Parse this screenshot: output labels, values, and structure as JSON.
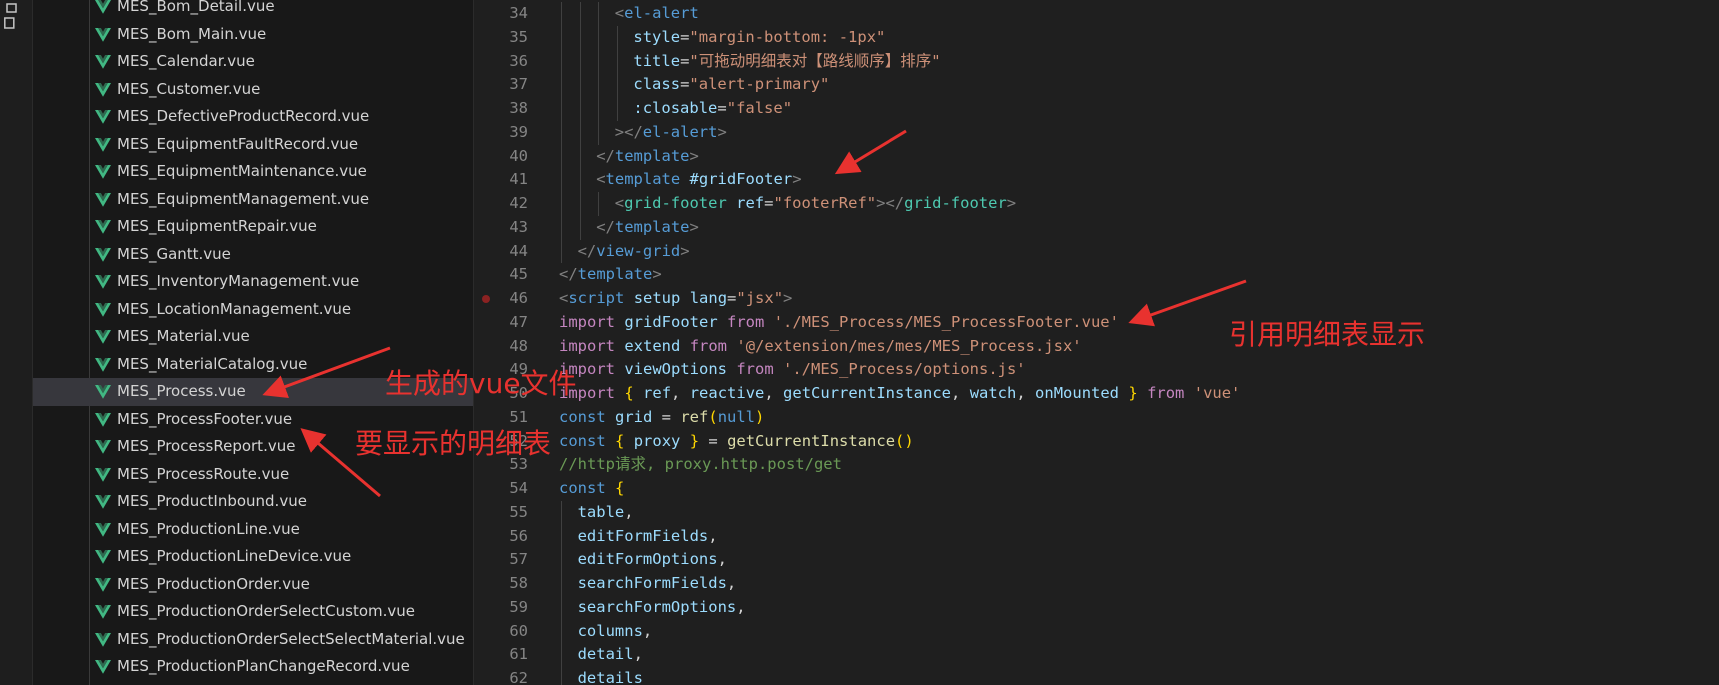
{
  "explorer": {
    "files": [
      {
        "name": "MES_Bom_Detail.vue"
      },
      {
        "name": "MES_Bom_Main.vue"
      },
      {
        "name": "MES_Calendar.vue"
      },
      {
        "name": "MES_Customer.vue"
      },
      {
        "name": "MES_DefectiveProductRecord.vue"
      },
      {
        "name": "MES_EquipmentFaultRecord.vue"
      },
      {
        "name": "MES_EquipmentMaintenance.vue"
      },
      {
        "name": "MES_EquipmentManagement.vue"
      },
      {
        "name": "MES_EquipmentRepair.vue"
      },
      {
        "name": "MES_Gantt.vue"
      },
      {
        "name": "MES_InventoryManagement.vue"
      },
      {
        "name": "MES_LocationManagement.vue"
      },
      {
        "name": "MES_Material.vue"
      },
      {
        "name": "MES_MaterialCatalog.vue"
      },
      {
        "name": "MES_Process.vue",
        "active": true
      },
      {
        "name": "MES_ProcessFooter.vue"
      },
      {
        "name": "MES_ProcessReport.vue"
      },
      {
        "name": "MES_ProcessRoute.vue"
      },
      {
        "name": "MES_ProductInbound.vue"
      },
      {
        "name": "MES_ProductionLine.vue"
      },
      {
        "name": "MES_ProductionLineDevice.vue"
      },
      {
        "name": "MES_ProductionOrder.vue"
      },
      {
        "name": "MES_ProductionOrderSelectCustom.vue"
      },
      {
        "name": "MES_ProductionOrderSelectSelectMaterial.vue"
      },
      {
        "name": "MES_ProductionPlanChangeRecord.vue"
      }
    ]
  },
  "editor": {
    "lines": [
      {
        "n": "34",
        "indent": 3,
        "tokens": [
          [
            "t-punc",
            "<"
          ],
          [
            "t-tag",
            "el-alert"
          ]
        ]
      },
      {
        "n": "35",
        "indent": 4,
        "tokens": [
          [
            "t-attr",
            "style"
          ],
          [
            "t-plain",
            "="
          ],
          [
            "t-str",
            "\"margin-bottom: -1px\""
          ]
        ]
      },
      {
        "n": "36",
        "indent": 4,
        "tokens": [
          [
            "t-attr",
            "title"
          ],
          [
            "t-plain",
            "="
          ],
          [
            "t-str",
            "\"可拖动明细表对【路线顺序】排序\""
          ]
        ]
      },
      {
        "n": "37",
        "indent": 4,
        "tokens": [
          [
            "t-attr",
            "class"
          ],
          [
            "t-plain",
            "="
          ],
          [
            "t-str",
            "\"alert-primary\""
          ]
        ]
      },
      {
        "n": "38",
        "indent": 4,
        "tokens": [
          [
            "t-attr",
            ":closable"
          ],
          [
            "t-plain",
            "="
          ],
          [
            "t-str",
            "\"false\""
          ]
        ]
      },
      {
        "n": "39",
        "indent": 3,
        "tokens": [
          [
            "t-punc",
            "></"
          ],
          [
            "t-tag",
            "el-alert"
          ],
          [
            "t-punc",
            ">"
          ]
        ]
      },
      {
        "n": "40",
        "indent": 2,
        "tokens": [
          [
            "t-punc",
            "</"
          ],
          [
            "t-tag",
            "template"
          ],
          [
            "t-punc",
            ">"
          ]
        ]
      },
      {
        "n": "41",
        "indent": 2,
        "tokens": [
          [
            "t-punc",
            "<"
          ],
          [
            "t-tag",
            "template"
          ],
          [
            "t-plain",
            " "
          ],
          [
            "t-attr",
            "#gridFooter"
          ],
          [
            "t-punc",
            ">"
          ]
        ]
      },
      {
        "n": "42",
        "indent": 3,
        "tokens": [
          [
            "t-punc",
            "<"
          ],
          [
            "t-teal",
            "grid-footer"
          ],
          [
            "t-plain",
            " "
          ],
          [
            "t-attr",
            "ref"
          ],
          [
            "t-plain",
            "="
          ],
          [
            "t-str",
            "\"footerRef\""
          ],
          [
            "t-punc",
            "></"
          ],
          [
            "t-teal",
            "grid-footer"
          ],
          [
            "t-punc",
            ">"
          ]
        ]
      },
      {
        "n": "43",
        "indent": 2,
        "tokens": [
          [
            "t-punc",
            "</"
          ],
          [
            "t-tag",
            "template"
          ],
          [
            "t-punc",
            ">"
          ]
        ]
      },
      {
        "n": "44",
        "indent": 1,
        "tokens": [
          [
            "t-punc",
            "</"
          ],
          [
            "t-tag",
            "view-grid"
          ],
          [
            "t-punc",
            ">"
          ]
        ]
      },
      {
        "n": "45",
        "indent": 0,
        "tokens": [
          [
            "t-punc",
            "</"
          ],
          [
            "t-tag",
            "template"
          ],
          [
            "t-punc",
            ">"
          ]
        ]
      },
      {
        "n": "46",
        "indent": 0,
        "breakpoint": true,
        "tokens": [
          [
            "t-punc",
            "<"
          ],
          [
            "t-tag",
            "script"
          ],
          [
            "t-plain",
            " "
          ],
          [
            "t-attr",
            "setup"
          ],
          [
            "t-plain",
            " "
          ],
          [
            "t-attr",
            "lang"
          ],
          [
            "t-plain",
            "="
          ],
          [
            "t-str",
            "\"jsx\""
          ],
          [
            "t-punc",
            ">"
          ]
        ]
      },
      {
        "n": "47",
        "indent": 0,
        "tokens": [
          [
            "t-kw",
            "import"
          ],
          [
            "t-plain",
            " "
          ],
          [
            "t-var",
            "gridFooter"
          ],
          [
            "t-plain",
            " "
          ],
          [
            "t-kw",
            "from"
          ],
          [
            "t-plain",
            " "
          ],
          [
            "t-str",
            "'./MES_Process/MES_ProcessFooter.vue'"
          ]
        ]
      },
      {
        "n": "48",
        "indent": 0,
        "tokens": [
          [
            "t-kw",
            "import"
          ],
          [
            "t-plain",
            " "
          ],
          [
            "t-var",
            "extend"
          ],
          [
            "t-plain",
            " "
          ],
          [
            "t-kw",
            "from"
          ],
          [
            "t-plain",
            " "
          ],
          [
            "t-str",
            "'@/extension/mes/mes/MES_Process.jsx'"
          ]
        ]
      },
      {
        "n": "49",
        "indent": 0,
        "tokens": [
          [
            "t-kw",
            "import"
          ],
          [
            "t-plain",
            " "
          ],
          [
            "t-var",
            "viewOptions"
          ],
          [
            "t-plain",
            " "
          ],
          [
            "t-kw",
            "from"
          ],
          [
            "t-plain",
            " "
          ],
          [
            "t-str",
            "'./MES_Process/options.js'"
          ]
        ]
      },
      {
        "n": "50",
        "indent": 0,
        "tokens": [
          [
            "t-kw",
            "import"
          ],
          [
            "t-plain",
            " "
          ],
          [
            "t-brace",
            "{"
          ],
          [
            "t-plain",
            " "
          ],
          [
            "t-var",
            "ref"
          ],
          [
            "t-plain",
            ", "
          ],
          [
            "t-var",
            "reactive"
          ],
          [
            "t-plain",
            ", "
          ],
          [
            "t-var",
            "getCurrentInstance"
          ],
          [
            "t-plain",
            ", "
          ],
          [
            "t-var",
            "watch"
          ],
          [
            "t-plain",
            ", "
          ],
          [
            "t-var",
            "onMounted"
          ],
          [
            "t-plain",
            " "
          ],
          [
            "t-brace",
            "}"
          ],
          [
            "t-plain",
            " "
          ],
          [
            "t-kw",
            "from"
          ],
          [
            "t-plain",
            " "
          ],
          [
            "t-str",
            "'vue'"
          ]
        ]
      },
      {
        "n": "51",
        "indent": 0,
        "tokens": [
          [
            "t-decl",
            "const"
          ],
          [
            "t-plain",
            " "
          ],
          [
            "t-var",
            "grid"
          ],
          [
            "t-plain",
            " = "
          ],
          [
            "t-fn",
            "ref"
          ],
          [
            "t-brace",
            "("
          ],
          [
            "t-decl",
            "null"
          ],
          [
            "t-brace",
            ")"
          ]
        ]
      },
      {
        "n": "52",
        "indent": 0,
        "tokens": [
          [
            "t-decl",
            "const"
          ],
          [
            "t-plain",
            " "
          ],
          [
            "t-brace",
            "{"
          ],
          [
            "t-plain",
            " "
          ],
          [
            "t-var",
            "proxy"
          ],
          [
            "t-plain",
            " "
          ],
          [
            "t-brace",
            "}"
          ],
          [
            "t-plain",
            " = "
          ],
          [
            "t-fn",
            "getCurrentInstance"
          ],
          [
            "t-brace",
            "()"
          ]
        ]
      },
      {
        "n": "53",
        "indent": 0,
        "tokens": [
          [
            "t-comment",
            "//http请求, proxy.http.post/get"
          ]
        ]
      },
      {
        "n": "54",
        "indent": 0,
        "tokens": [
          [
            "t-decl",
            "const"
          ],
          [
            "t-plain",
            " "
          ],
          [
            "t-brace",
            "{"
          ]
        ]
      },
      {
        "n": "55",
        "indent": 1,
        "tokens": [
          [
            "t-var",
            "table"
          ],
          [
            "t-plain",
            ","
          ]
        ]
      },
      {
        "n": "56",
        "indent": 1,
        "tokens": [
          [
            "t-var",
            "editFormFields"
          ],
          [
            "t-plain",
            ","
          ]
        ]
      },
      {
        "n": "57",
        "indent": 1,
        "tokens": [
          [
            "t-var",
            "editFormOptions"
          ],
          [
            "t-plain",
            ","
          ]
        ]
      },
      {
        "n": "58",
        "indent": 1,
        "tokens": [
          [
            "t-var",
            "searchFormFields"
          ],
          [
            "t-plain",
            ","
          ]
        ]
      },
      {
        "n": "59",
        "indent": 1,
        "tokens": [
          [
            "t-var",
            "searchFormOptions"
          ],
          [
            "t-plain",
            ","
          ]
        ]
      },
      {
        "n": "60",
        "indent": 1,
        "tokens": [
          [
            "t-var",
            "columns"
          ],
          [
            "t-plain",
            ","
          ]
        ]
      },
      {
        "n": "61",
        "indent": 1,
        "tokens": [
          [
            "t-var",
            "detail"
          ],
          [
            "t-plain",
            ","
          ]
        ]
      },
      {
        "n": "62",
        "indent": 1,
        "tokens": [
          [
            "t-var",
            "details"
          ]
        ]
      }
    ]
  },
  "annotations": {
    "generated_file": "生成的vue文件",
    "detail_table_to_show": "要显示的明细表",
    "reference_detail_table": "引用明细表显示",
    "color": "#e8322f"
  }
}
